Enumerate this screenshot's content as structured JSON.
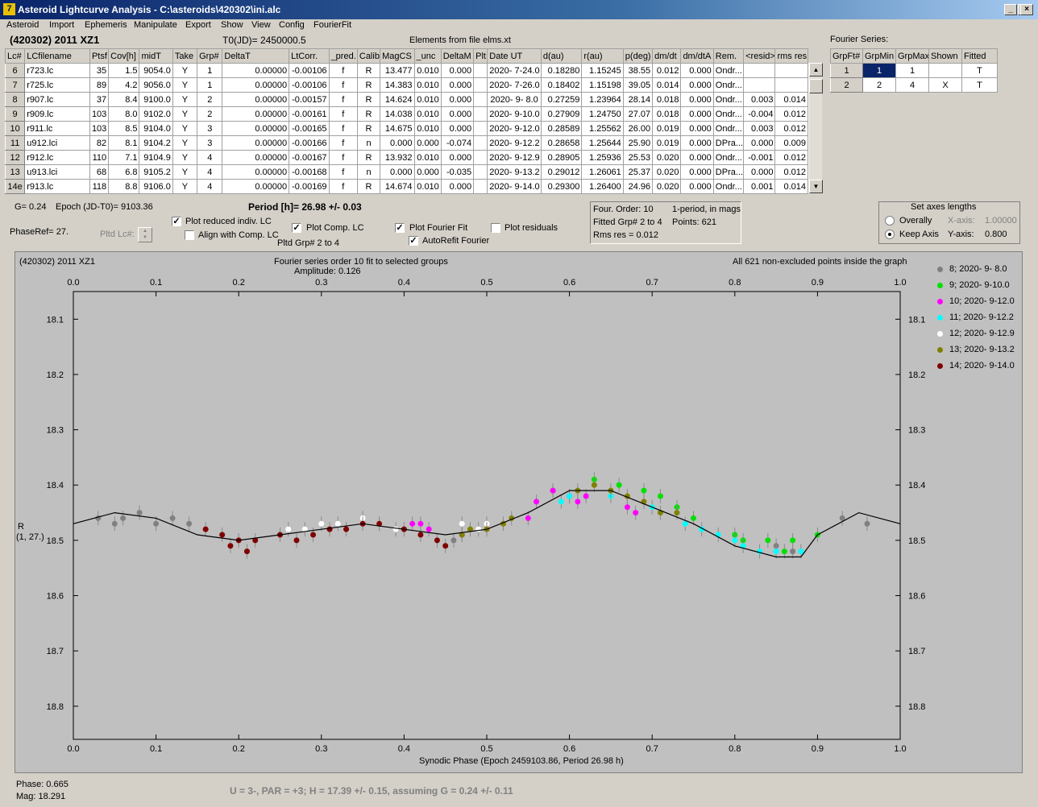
{
  "window": {
    "title": "Asteroid Lightcurve Analysis - C:\\asteroids\\420302\\ini.alc",
    "icon": "app-icon"
  },
  "menu": [
    "Asteroid",
    "Import",
    "Ephemeris",
    "Manipulate",
    "Export",
    "Show",
    "View",
    "Config",
    "FourierFit"
  ],
  "header": {
    "object": "(420302) 2011 XZ1",
    "t0": "T0(JD)= 2450000.5",
    "elements": "Elements from file elms.xt"
  },
  "lc_table": {
    "columns": [
      "Lc#",
      "LCfilename",
      "Ptsf",
      "Cov[h]",
      "midT",
      "Take",
      "Grp#",
      "DeltaT",
      "LtCorr.",
      "_pred.",
      "Calib.",
      "MagCS",
      "_unc",
      "DeltaM",
      "Plt",
      "Date UT",
      "d(au)",
      "r(au)",
      "p(deg)",
      "dm/dt",
      "dm/dtA",
      "Rem.",
      "<resid>",
      "rms res"
    ],
    "rows": [
      [
        "6",
        "r723.lc",
        "35",
        "1.5",
        "9054.0",
        "Y",
        "1",
        "0.00000",
        "-0.00106",
        "f",
        "R",
        "13.477",
        "0.010",
        "0.000",
        "",
        "2020- 7-24.0",
        "0.18280",
        "1.15245",
        "38.55",
        "0.012",
        "0.000",
        "Ondr...",
        "",
        ""
      ],
      [
        "7",
        "r725.lc",
        "89",
        "4.2",
        "9056.0",
        "Y",
        "1",
        "0.00000",
        "-0.00106",
        "f",
        "R",
        "14.383",
        "0.010",
        "0.000",
        "",
        "2020- 7-26.0",
        "0.18402",
        "1.15198",
        "39.05",
        "0.014",
        "0.000",
        "Ondr...",
        "",
        ""
      ],
      [
        "8",
        "r907.lc",
        "37",
        "8.4",
        "9100.0",
        "Y",
        "2",
        "0.00000",
        "-0.00157",
        "f",
        "R",
        "14.624",
        "0.010",
        "0.000",
        "",
        "2020- 9- 8.0",
        "0.27259",
        "1.23964",
        "28.14",
        "0.018",
        "0.000",
        "Ondr...",
        "0.003",
        "0.014"
      ],
      [
        "9",
        "r909.lc",
        "103",
        "8.0",
        "9102.0",
        "Y",
        "2",
        "0.00000",
        "-0.00161",
        "f",
        "R",
        "14.038",
        "0.010",
        "0.000",
        "",
        "2020- 9-10.0",
        "0.27909",
        "1.24750",
        "27.07",
        "0.018",
        "0.000",
        "Ondr...",
        "-0.004",
        "0.012"
      ],
      [
        "10",
        "r911.lc",
        "103",
        "8.5",
        "9104.0",
        "Y",
        "3",
        "0.00000",
        "-0.00165",
        "f",
        "R",
        "14.675",
        "0.010",
        "0.000",
        "",
        "2020- 9-12.0",
        "0.28589",
        "1.25562",
        "26.00",
        "0.019",
        "0.000",
        "Ondr...",
        "0.003",
        "0.012"
      ],
      [
        "11",
        "u912.lci",
        "82",
        "8.1",
        "9104.2",
        "Y",
        "3",
        "0.00000",
        "-0.00166",
        "f",
        "n",
        "0.000",
        "0.000",
        "-0.074",
        "",
        "2020- 9-12.2",
        "0.28658",
        "1.25644",
        "25.90",
        "0.019",
        "0.000",
        "DPra...",
        "0.000",
        "0.009"
      ],
      [
        "12",
        "r912.lc",
        "110",
        "7.1",
        "9104.9",
        "Y",
        "4",
        "0.00000",
        "-0.00167",
        "f",
        "R",
        "13.932",
        "0.010",
        "0.000",
        "",
        "2020- 9-12.9",
        "0.28905",
        "1.25936",
        "25.53",
        "0.020",
        "0.000",
        "Ondr...",
        "-0.001",
        "0.012"
      ],
      [
        "13",
        "u913.lci",
        "68",
        "6.8",
        "9105.2",
        "Y",
        "4",
        "0.00000",
        "-0.00168",
        "f",
        "n",
        "0.000",
        "0.000",
        "-0.035",
        "",
        "2020- 9-13.2",
        "0.29012",
        "1.26061",
        "25.37",
        "0.020",
        "0.000",
        "DPra...",
        "0.000",
        "0.012"
      ],
      [
        "14e",
        "r913.lc",
        "118",
        "8.8",
        "9106.0",
        "Y",
        "4",
        "0.00000",
        "-0.00169",
        "f",
        "R",
        "14.674",
        "0.010",
        "0.000",
        "",
        "2020- 9-14.0",
        "0.29300",
        "1.26400",
        "24.96",
        "0.020",
        "0.000",
        "Ondr...",
        "0.001",
        "0.014"
      ]
    ]
  },
  "fourier_series": {
    "title": "Fourier Series:",
    "columns": [
      "GrpFt#",
      "GrpMin",
      "GrpMax",
      "Shown",
      "Fitted"
    ],
    "rows": [
      [
        "1",
        "1",
        "1",
        "",
        "T"
      ],
      [
        "2",
        "2",
        "4",
        "X",
        "T"
      ]
    ]
  },
  "controls": {
    "g": "G= 0.24",
    "epoch": "Epoch (JD-T0)= 9103.36",
    "period": "Period [h]= 26.98 +/- 0.03",
    "phase_ref": "PhaseRef= 27.",
    "pltd_lc": "Pltd Lc#:",
    "plot_reduced": "Plot reduced indiv. LC",
    "align_comp": "Align with Comp. LC",
    "plot_comp": "Plot Comp. LC",
    "pltd_grp": "Pltd Grp#  2   to   4",
    "plot_fourier": "Plot Fourier Fit",
    "autorefit": "AutoRefit Fourier",
    "plot_residuals": "Plot residuals",
    "checks": {
      "plot_reduced": true,
      "align_comp": false,
      "plot_comp": true,
      "plot_fourier": true,
      "autorefit": true,
      "plot_residuals": false
    }
  },
  "fit_info": {
    "order": "Four. Order: 10",
    "period_mode": "1-period, in mags",
    "fitted": "Fitted Grp# 2 to 4",
    "points": "Points: 621",
    "rms": "Rms res     = 0.012"
  },
  "axes_box": {
    "title": "Set axes lengths",
    "overally": "Overally",
    "keep": "Keep Axis",
    "xaxis_label": "X-axis:",
    "xaxis_val": "1.00000",
    "yaxis_label": "Y-axis:",
    "yaxis_val": "0.800",
    "selected": "keep"
  },
  "plot_text": {
    "name": "(420302) 2011 XZ1",
    "caption": "Fourier series order 10 fit to selected groups",
    "amplitude": "Amplitude: 0.126",
    "count": "All 621 non-excluded points inside the graph",
    "ylabel": "R",
    "ylabel2": "(1, 27.)",
    "xlabel": "Synodic Phase (Epoch 2459103.86, Period 26.98 h)"
  },
  "footer": {
    "phase": "Phase:  0.665",
    "mag": "Mag:    18.291",
    "result": "U = 3-, PAR = +3; H = 17.39 +/- 0.15, assuming G = 0.24 +/- 0.11"
  },
  "chart_data": {
    "type": "scatter",
    "xlim": [
      0,
      1
    ],
    "ylim": [
      18.8,
      18.1
    ],
    "x_ticks": [
      "0.0",
      "0.1",
      "0.2",
      "0.3",
      "0.4",
      "0.5",
      "0.6",
      "0.7",
      "0.8",
      "0.9",
      "1.0"
    ],
    "y_ticks": [
      "18.1",
      "18.2",
      "18.3",
      "18.4",
      "18.5",
      "18.6",
      "18.7",
      "18.8"
    ],
    "fit_curve": {
      "x": [
        0,
        0.05,
        0.1,
        0.15,
        0.2,
        0.25,
        0.3,
        0.35,
        0.4,
        0.45,
        0.5,
        0.55,
        0.6,
        0.65,
        0.7,
        0.75,
        0.8,
        0.85,
        0.88,
        0.9,
        0.95,
        1.0
      ],
      "y": [
        18.47,
        18.45,
        18.46,
        18.49,
        18.5,
        18.49,
        18.48,
        18.47,
        18.48,
        18.49,
        18.48,
        18.45,
        18.41,
        18.41,
        18.44,
        18.47,
        18.51,
        18.53,
        18.53,
        18.49,
        18.45,
        18.47
      ]
    },
    "series": [
      {
        "name": "8; 2020- 9- 8.0",
        "color": "#808080",
        "x": [
          0.03,
          0.05,
          0.06,
          0.08,
          0.1,
          0.12,
          0.14,
          0.46,
          0.85,
          0.87,
          0.93,
          0.96
        ],
        "y": [
          18.46,
          18.47,
          18.46,
          18.45,
          18.47,
          18.46,
          18.47,
          18.5,
          18.51,
          18.52,
          18.46,
          18.47
        ]
      },
      {
        "name": "9; 2020- 9-10.0",
        "color": "#00e000",
        "x": [
          0.58,
          0.63,
          0.66,
          0.69,
          0.71,
          0.73,
          0.75,
          0.8,
          0.81,
          0.84,
          0.86,
          0.87,
          0.9
        ],
        "y": [
          18.41,
          18.39,
          18.4,
          18.41,
          18.42,
          18.44,
          18.46,
          18.49,
          18.5,
          18.5,
          18.52,
          18.5,
          18.49
        ]
      },
      {
        "name": "10; 2020- 9-12.0",
        "color": "#ff00ff",
        "x": [
          0.41,
          0.42,
          0.43,
          0.47,
          0.5,
          0.55,
          0.56,
          0.58,
          0.6,
          0.61,
          0.62,
          0.67,
          0.68
        ],
        "y": [
          18.47,
          18.47,
          18.48,
          18.49,
          18.48,
          18.46,
          18.43,
          18.41,
          18.42,
          18.43,
          18.42,
          18.44,
          18.45
        ]
      },
      {
        "name": "11; 2020- 9-12.2",
        "color": "#00ffff",
        "x": [
          0.59,
          0.6,
          0.65,
          0.7,
          0.74,
          0.76,
          0.78,
          0.8,
          0.81,
          0.83,
          0.85,
          0.88
        ],
        "y": [
          18.43,
          18.42,
          18.42,
          18.44,
          18.47,
          18.48,
          18.49,
          18.5,
          18.51,
          18.52,
          18.52,
          18.52
        ]
      },
      {
        "name": "12; 2020- 9-12.9",
        "color": "#ffffff",
        "x": [
          0.26,
          0.28,
          0.3,
          0.32,
          0.35,
          0.37,
          0.39,
          0.47,
          0.49,
          0.5
        ],
        "y": [
          18.48,
          18.48,
          18.47,
          18.47,
          18.46,
          18.47,
          18.48,
          18.47,
          18.48,
          18.47
        ]
      },
      {
        "name": "13; 2020- 9-13.2",
        "color": "#808000",
        "x": [
          0.47,
          0.48,
          0.5,
          0.52,
          0.53,
          0.61,
          0.63,
          0.65,
          0.67,
          0.69,
          0.71,
          0.73
        ],
        "y": [
          18.49,
          18.48,
          18.48,
          18.47,
          18.46,
          18.41,
          18.4,
          18.41,
          18.42,
          18.43,
          18.45,
          18.45
        ]
      },
      {
        "name": "14; 2020- 9-14.0",
        "color": "#800000",
        "x": [
          0.16,
          0.18,
          0.19,
          0.2,
          0.21,
          0.22,
          0.25,
          0.27,
          0.29,
          0.31,
          0.33,
          0.35,
          0.37,
          0.4,
          0.42,
          0.44,
          0.45
        ],
        "y": [
          18.48,
          18.49,
          18.51,
          18.5,
          18.52,
          18.5,
          18.49,
          18.5,
          18.49,
          18.48,
          18.48,
          18.47,
          18.47,
          18.48,
          18.49,
          18.5,
          18.51
        ]
      }
    ]
  }
}
